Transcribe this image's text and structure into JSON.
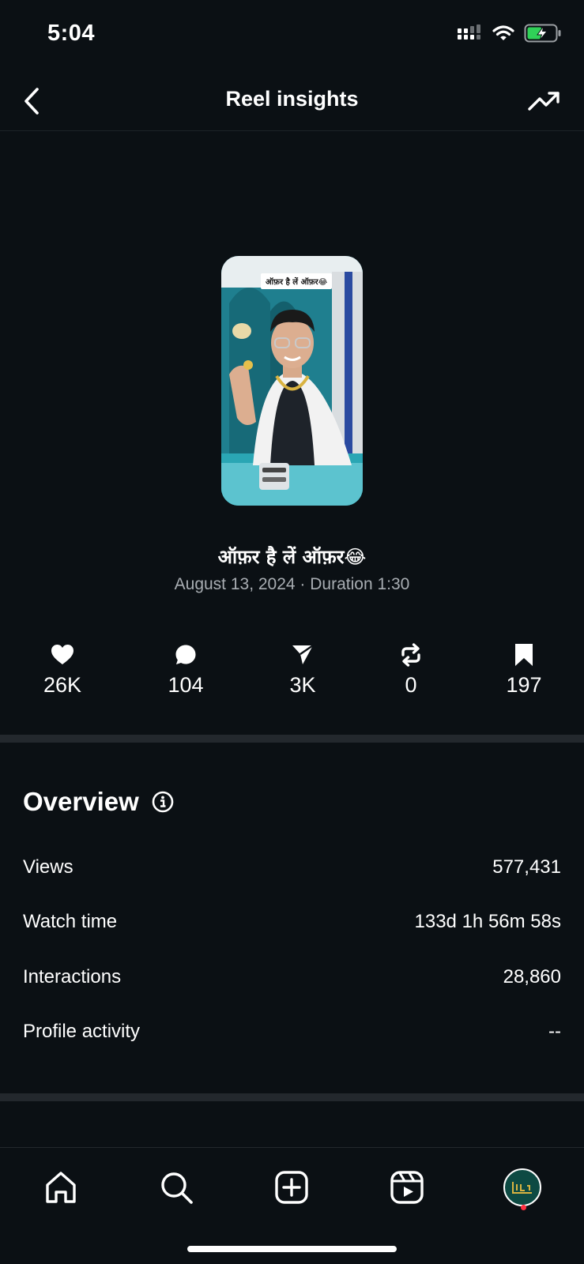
{
  "status_bar": {
    "time": "5:04"
  },
  "header": {
    "title": "Reel insights"
  },
  "reel": {
    "thumbnail_caption": "ऑफ़र है लें ऑफ़र😂",
    "title": "ऑफ़र है लें ऑफ़र😂",
    "meta": "August 13, 2024 · Duration 1:30"
  },
  "stats": [
    {
      "icon": "heart-icon",
      "value": "26K"
    },
    {
      "icon": "comment-icon",
      "value": "104"
    },
    {
      "icon": "share-icon",
      "value": "3K"
    },
    {
      "icon": "repost-icon",
      "value": "0"
    },
    {
      "icon": "bookmark-icon",
      "value": "197"
    }
  ],
  "overview": {
    "title": "Overview",
    "rows": [
      {
        "label": "Views",
        "value": "577,431"
      },
      {
        "label": "Watch time",
        "value": "133d 1h 56m 58s"
      },
      {
        "label": "Interactions",
        "value": "28,860"
      },
      {
        "label": "Profile activity",
        "value": "--"
      }
    ]
  },
  "bottom_nav": [
    "home-icon",
    "search-icon",
    "create-icon",
    "reels-icon",
    "profile-avatar"
  ],
  "colors": {
    "background": "#0b1014",
    "divider": "#23282d",
    "secondary_text": "#a8adb2",
    "battery": "#30d158",
    "notification": "#ff3040"
  }
}
